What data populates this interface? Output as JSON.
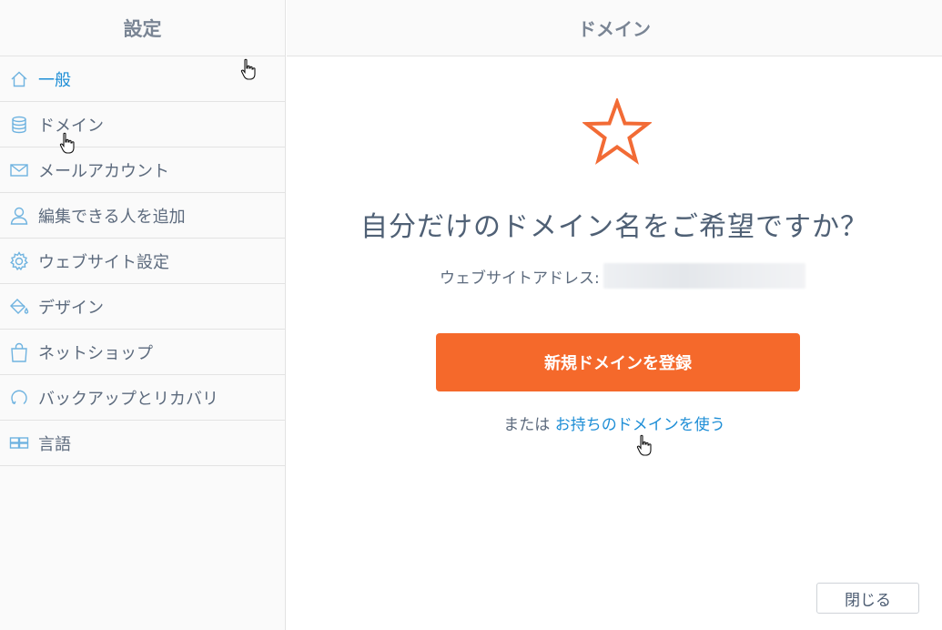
{
  "sidebar": {
    "title": "設定",
    "items": [
      {
        "label": "一般",
        "icon": "home-icon",
        "active": true
      },
      {
        "label": "ドメイン",
        "icon": "database-icon",
        "active": false
      },
      {
        "label": "メールアカウント",
        "icon": "mail-icon",
        "active": false
      },
      {
        "label": "編集できる人を追加",
        "icon": "user-icon",
        "active": false
      },
      {
        "label": "ウェブサイト設定",
        "icon": "gear-icon",
        "active": false
      },
      {
        "label": "デザイン",
        "icon": "paint-bucket-icon",
        "active": false
      },
      {
        "label": "ネットショップ",
        "icon": "shopping-bag-icon",
        "active": false
      },
      {
        "label": "バックアップとリカバリ",
        "icon": "restore-icon",
        "active": false
      },
      {
        "label": "言語",
        "icon": "language-icon",
        "active": false
      }
    ]
  },
  "main": {
    "title": "ドメイン",
    "headline": "自分だけのドメイン名をご希望ですか？",
    "address_label": "ウェブサイトアドレス:",
    "register_button": "新規ドメインを登録",
    "or_text": "または",
    "existing_domain_link": "お持ちのドメインを使う",
    "close_button": "閉じる"
  },
  "colors": {
    "accent_orange": "#f5692b",
    "link_blue": "#1e8ed6",
    "star_orange": "#f26b35"
  }
}
